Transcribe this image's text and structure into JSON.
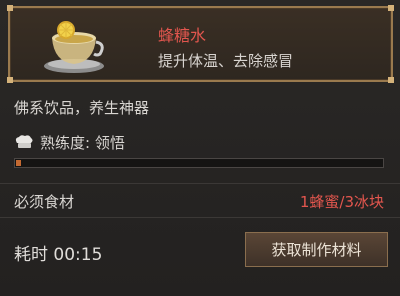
{
  "item": {
    "name": "蜂糖水",
    "description": "提升体温、去除感冒",
    "icon": "honey-water-cup-icon"
  },
  "flavor_text": "佛系饮品，养生神器",
  "proficiency": {
    "label": "熟练度: 领悟",
    "icon": "chef-hat-icon",
    "progress": 0.015
  },
  "ingredients": {
    "label": "必须食材",
    "value": "1蜂蜜/3冰块"
  },
  "time": {
    "label": "耗时 00:15"
  },
  "action_button": {
    "label": "获取制作材料"
  },
  "colors": {
    "accent_red": "#e2564e",
    "frame_gold": "#9a7a4e",
    "progress_fill": "#c46a32"
  }
}
